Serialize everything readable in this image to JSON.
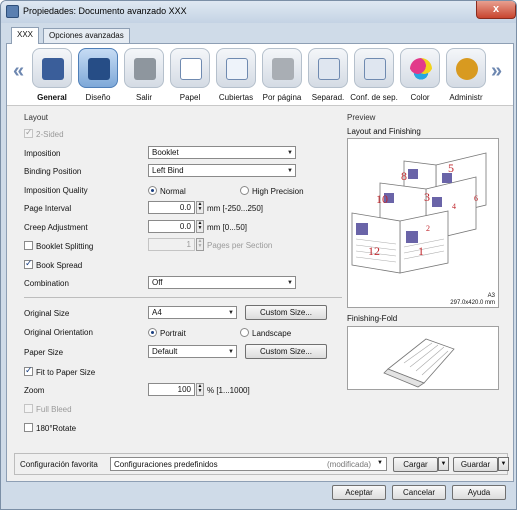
{
  "window": {
    "title": "Propiedades: Documento avanzado XXX",
    "close": "x"
  },
  "tabs": [
    "XXX",
    "Opciones avanzadas"
  ],
  "iconbar": {
    "left_arrow": "«",
    "right_arrow": "»",
    "items": [
      {
        "label": "General",
        "icon": "printer-general-icon"
      },
      {
        "label": "Diseño",
        "icon": "layout-design-icon"
      },
      {
        "label": "Salir",
        "icon": "output-tray-icon"
      },
      {
        "label": "Papel",
        "icon": "paper-icon"
      },
      {
        "label": "Cubiertas",
        "icon": "covers-icon"
      },
      {
        "label": "Por página",
        "icon": "per-page-icon"
      },
      {
        "label": "Separad.",
        "icon": "separator-icon"
      },
      {
        "label": "Conf. de sep.",
        "icon": "separator-settings-icon"
      },
      {
        "label": "Color",
        "icon": "color-icon"
      },
      {
        "label": "Administr",
        "icon": "administration-icon"
      }
    ]
  },
  "layout": {
    "section_title": "Layout",
    "two_sided": "2-Sided",
    "imposition_label": "Imposition",
    "imposition_value": "Booklet",
    "binding_label": "Binding Position",
    "binding_value": "Left Bind",
    "quality_label": "Imposition Quality",
    "quality_normal": "Normal",
    "quality_high": "High Precision",
    "page_interval_label": "Page Interval",
    "page_interval_value": "0.0",
    "page_interval_unit": "mm [-250...250]",
    "creep_label": "Creep Adjustment",
    "creep_value": "0.0",
    "creep_unit": "mm [0...50]",
    "booklet_splitting": "Booklet Splitting",
    "booklet_pages_value": "1",
    "booklet_pages_unit": "Pages per Section",
    "book_spread": "Book Spread",
    "combination_label": "Combination",
    "combination_value": "Off",
    "original_size_label": "Original Size",
    "original_size_value": "A4",
    "custom_size_button": "Custom Size...",
    "orientation_label": "Original Orientation",
    "orientation_portrait": "Portrait",
    "orientation_landscape": "Landscape",
    "paper_size_label": "Paper Size",
    "paper_size_value": "Default",
    "paper_custom_size_button": "Custom Size...",
    "fit_to_paper": "Fit to Paper Size",
    "zoom_label": "Zoom",
    "zoom_value": "100",
    "zoom_unit": "% [1...1000]",
    "full_bleed": "Full Bleed",
    "rotate": "180°Rotate"
  },
  "preview": {
    "title": "Preview",
    "layout_title": "Layout and Finishing",
    "page_numbers": [
      "8",
      "5",
      "6",
      "10",
      "3",
      "4",
      "2",
      "12",
      "1"
    ],
    "paper_name": "A3",
    "paper_dims": "297.0x420.0 mm",
    "finishing_title": "Finishing-Fold"
  },
  "footer": {
    "favorite_label": "Configuración favorita",
    "favorite_value": "Configuraciones predefinidos",
    "favorite_state": "(modificada)",
    "load_button": "Cargar",
    "save_button": "Guardar"
  },
  "buttons": {
    "ok": "Aceptar",
    "cancel": "Cancelar",
    "help": "Ayuda"
  }
}
